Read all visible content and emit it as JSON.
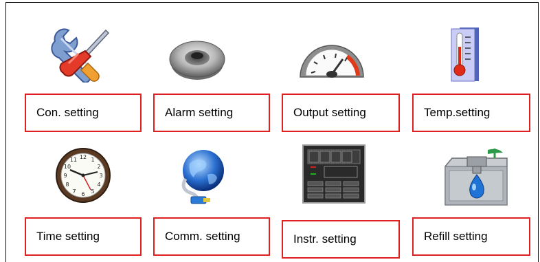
{
  "accent_color": "#e02020",
  "tiles": [
    {
      "label": "Con. setting",
      "icon": "tools-icon"
    },
    {
      "label": "Alarm setting",
      "icon": "speaker-icon"
    },
    {
      "label": "Output setting",
      "icon": "gauge-icon"
    },
    {
      "label": "Temp.setting",
      "icon": "thermometer-icon"
    },
    {
      "label": "Time setting",
      "icon": "clock-icon"
    },
    {
      "label": "Comm. setting",
      "icon": "network-globe-icon"
    },
    {
      "label": "Instr. setting",
      "icon": "instrument-panel-icon"
    },
    {
      "label": "Refill setting",
      "icon": "refill-tap-icon"
    }
  ]
}
